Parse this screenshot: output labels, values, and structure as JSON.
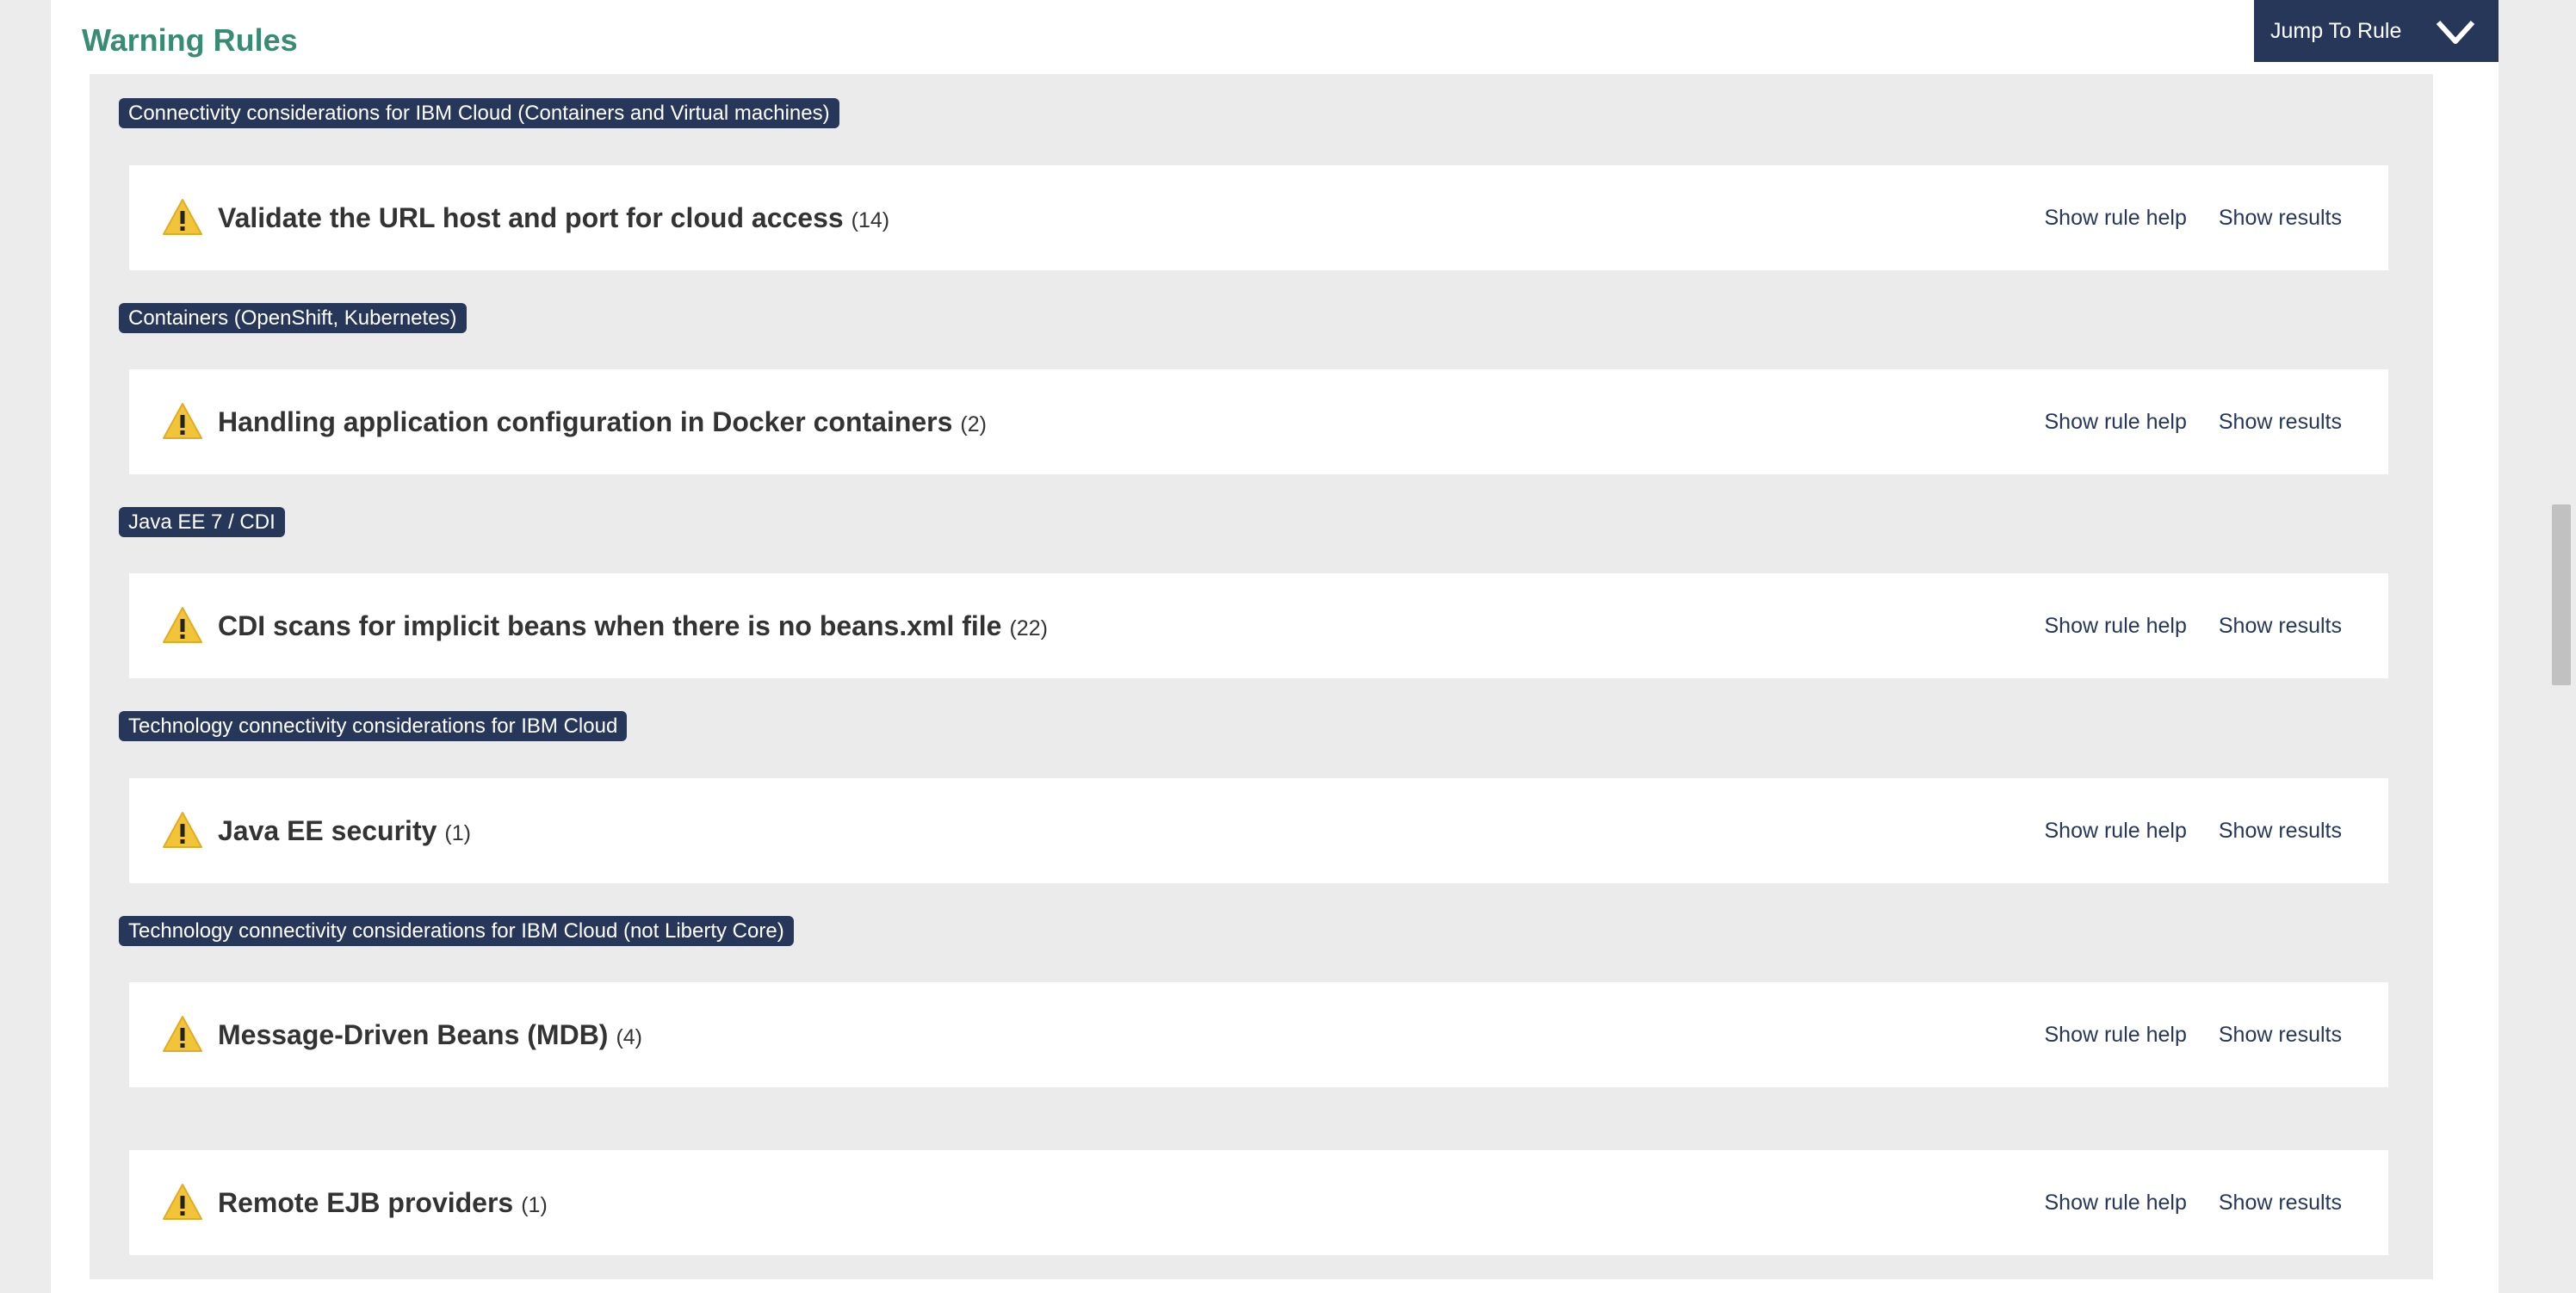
{
  "section": {
    "title": "Warning Rules",
    "jump_label": "Jump To Rule"
  },
  "groups": [
    {
      "category": "Connectivity considerations for IBM Cloud (Containers and Virtual machines)",
      "rule": {
        "name": "Validate the URL host and port for cloud access",
        "count": "(14)",
        "help": "Show rule help",
        "results": "Show results"
      }
    },
    {
      "category": "Containers (OpenShift, Kubernetes)",
      "rule": {
        "name": "Handling application configuration in Docker containers",
        "count": "(2)",
        "help": "Show rule help",
        "results": "Show results"
      }
    },
    {
      "category": "Java EE 7 / CDI",
      "rule": {
        "name": "CDI scans for implicit beans when there is no beans.xml file",
        "count": "(22)",
        "help": "Show rule help",
        "results": "Show results"
      }
    },
    {
      "category": "Technology connectivity considerations for IBM Cloud",
      "rule": {
        "name": "Java EE security",
        "count": "(1)",
        "help": "Show rule help",
        "results": "Show results"
      }
    },
    {
      "category": "Technology connectivity considerations for IBM Cloud (not Liberty Core)",
      "rule": {
        "name": "Message-Driven Beans (MDB)",
        "count": "(4)",
        "help": "Show rule help",
        "results": "Show results"
      }
    },
    {
      "category": "",
      "rule": {
        "name": "Remote EJB providers",
        "count": "(1)",
        "help": "Show rule help",
        "results": "Show results"
      }
    }
  ],
  "icons": {
    "warning": "warning-icon",
    "jump": "chevron-down-icon"
  },
  "colors": {
    "title_green": "#3a8b74",
    "navy": "#26375a",
    "warning_yellow": "#f2c43a",
    "panel_gray": "#ebebeb"
  }
}
